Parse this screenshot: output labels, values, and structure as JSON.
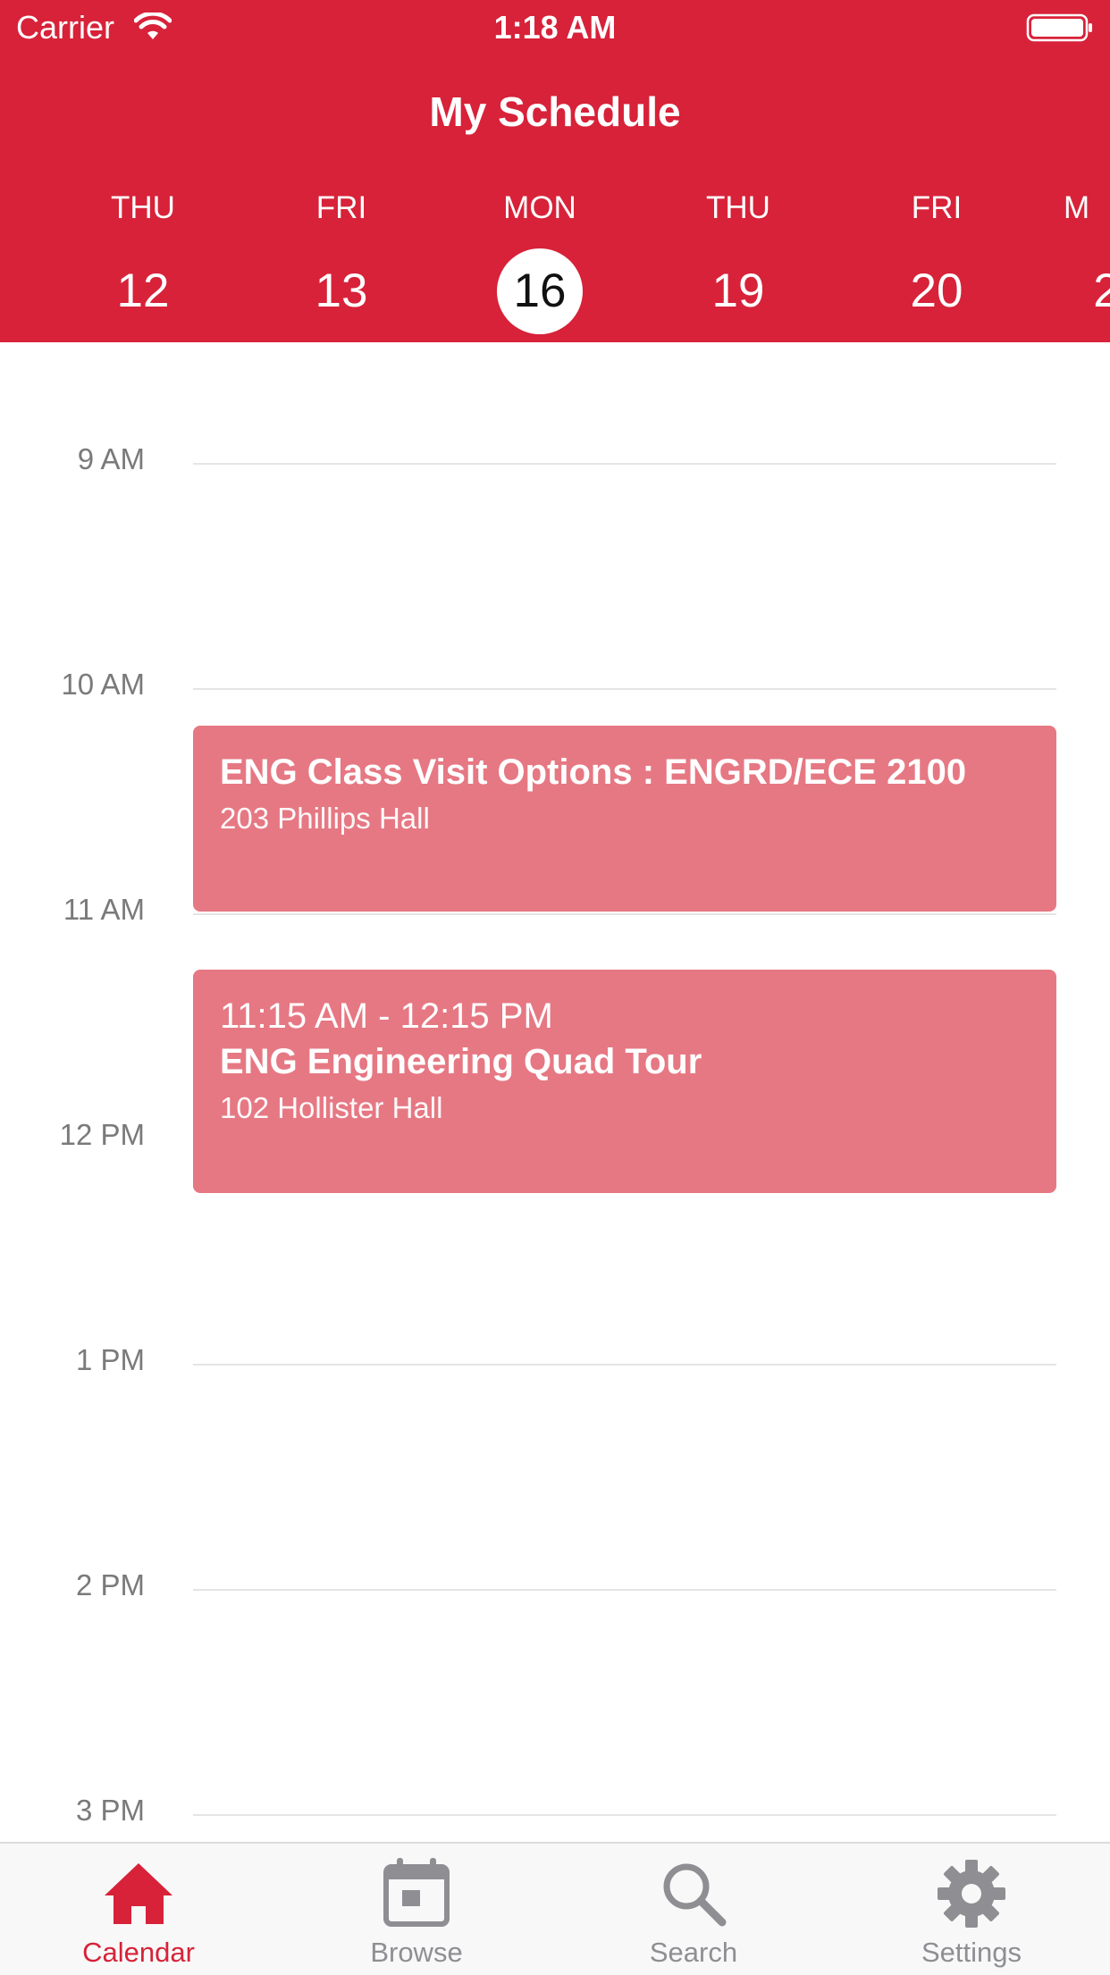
{
  "status_bar": {
    "carrier": "Carrier",
    "time": "1:18 AM"
  },
  "header": {
    "title": "My Schedule"
  },
  "days": [
    {
      "name": "THU",
      "num": "12"
    },
    {
      "name": "FRI",
      "num": "13"
    },
    {
      "name": "MON",
      "num": "16",
      "selected": true
    },
    {
      "name": "THU",
      "num": "19"
    },
    {
      "name": "FRI",
      "num": "20"
    },
    {
      "name": "M",
      "num": "2"
    }
  ],
  "hours": [
    "9 AM",
    "10 AM",
    "11 AM",
    "12 PM",
    "1 PM",
    "2 PM",
    "3 PM"
  ],
  "events": [
    {
      "time": "",
      "title": "ENG Class Visit Options : ENGRD/ECE 2100",
      "location": "203 Phillips Hall"
    },
    {
      "time": "11:15 AM - 12:15 PM",
      "title": "ENG Engineering Quad Tour",
      "location": "102 Hollister Hall"
    }
  ],
  "tabs": [
    {
      "label": "Calendar",
      "icon": "home-icon",
      "active": true
    },
    {
      "label": "Browse",
      "icon": "calendar-icon"
    },
    {
      "label": "Search",
      "icon": "search-icon"
    },
    {
      "label": "Settings",
      "icon": "gear-icon"
    }
  ],
  "colors": {
    "accent": "#d72239",
    "event": "#e67883",
    "tab_inactive": "#8e8e93"
  }
}
